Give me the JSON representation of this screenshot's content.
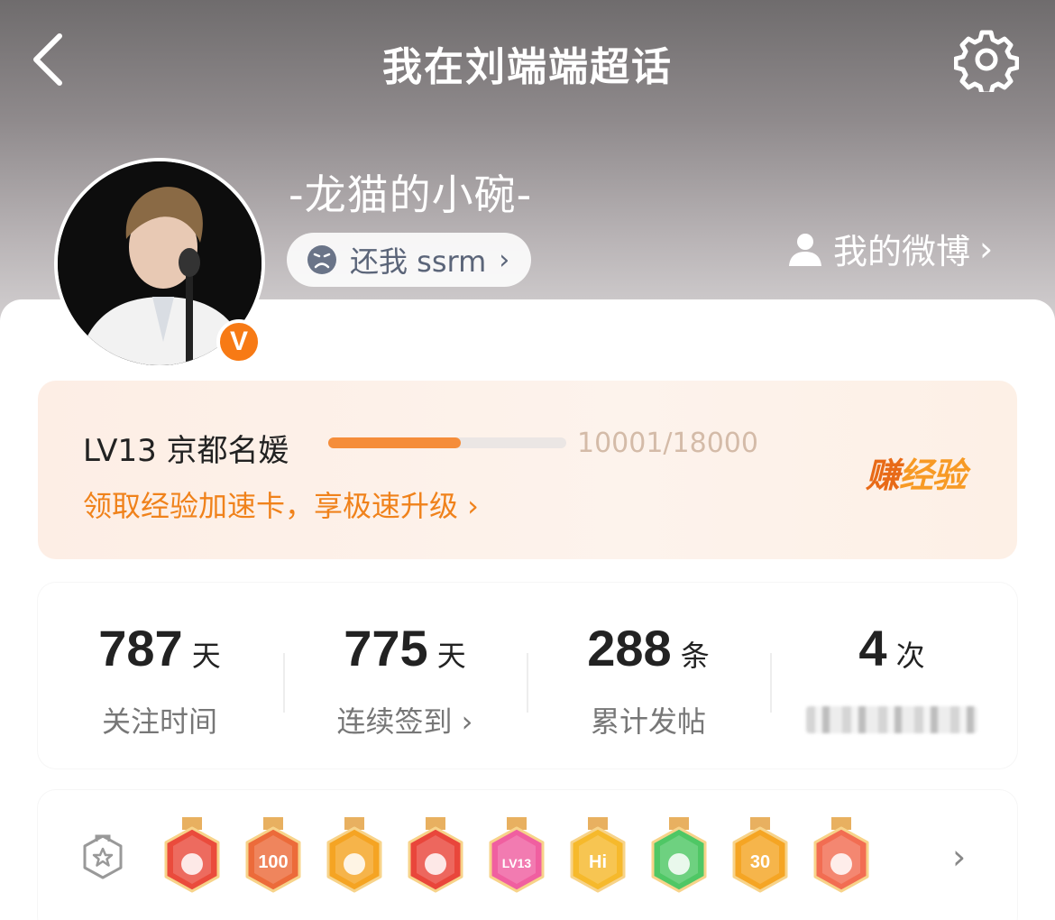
{
  "header": {
    "title": "我在刘端端超话",
    "back_icon": "chevron-left-icon",
    "settings_icon": "gear-icon"
  },
  "profile": {
    "nickname": "-龙猫的小碗-",
    "verified_badge": "V",
    "tag_label": "还我 ssrm",
    "tag_icon": "sad-face-icon",
    "my_weibo_label": "我的微博",
    "my_weibo_chevron": "›"
  },
  "level": {
    "label": "LV13 京都名媛",
    "progress_text": "10001/18000",
    "progress_fraction": 0.556,
    "speed_card_link": "领取经验加速卡，享极速升级 ›",
    "earn_part1": "赚",
    "earn_part2": "经验",
    "accent_color": "#f0821b"
  },
  "stats": [
    {
      "value": "787",
      "unit": "天",
      "label": "关注时间"
    },
    {
      "value": "775",
      "unit": "天",
      "label": "连续签到 ›"
    },
    {
      "value": "288",
      "unit": "条",
      "label": "累计发帖"
    },
    {
      "value": "4",
      "unit": "次",
      "label": ""
    }
  ],
  "badges": {
    "items": [
      {
        "name": "cat-badge",
        "color": "#ea4b3c"
      },
      {
        "name": "100-days-badge",
        "color": "#ec6b3a",
        "text": "100"
      },
      {
        "name": "crown-badge",
        "color": "#f5a423"
      },
      {
        "name": "cat-red-badge",
        "color": "#e9463b"
      },
      {
        "name": "lv13-badge",
        "color": "#f05fa0",
        "text": "LV13"
      },
      {
        "name": "hi-badge",
        "color": "#f6b92c",
        "text": "Hi"
      },
      {
        "name": "hand-badge",
        "color": "#4fc765"
      },
      {
        "name": "30-days-badge",
        "color": "#f5a524",
        "text": "30"
      },
      {
        "name": "rock-hand-badge",
        "color": "#f26d52"
      }
    ]
  }
}
